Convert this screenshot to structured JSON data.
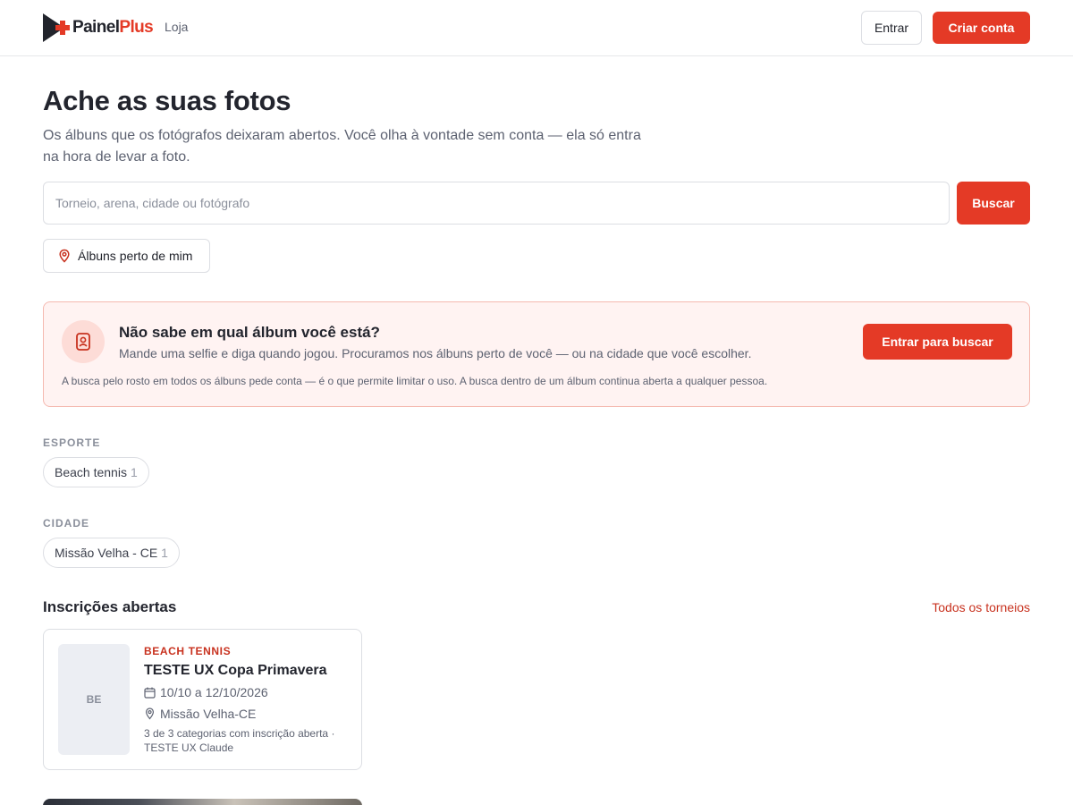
{
  "header": {
    "logo_text_a": "Painel",
    "logo_text_b": "Plus",
    "nav_store": "Loja",
    "login_label": "Entrar",
    "signup_label": "Criar conta"
  },
  "hero": {
    "title": "Ache as suas fotos",
    "subtitle": "Os álbuns que os fotógrafos deixaram abertos. Você olha à vontade sem conta — ela só entra na hora de levar a foto."
  },
  "search": {
    "placeholder": "Torneio, arena, cidade ou fotógrafo",
    "button_label": "Buscar",
    "near_label": "Álbuns perto de mim"
  },
  "promo": {
    "title": "Não sabe em qual álbum você está?",
    "text": "Mande uma selfie e diga quando jogou. Procuramos nos álbuns perto de você — ou na cidade que você escolher.",
    "note": "A busca pelo rosto em todos os álbuns pede conta — é o que permite limitar o uso. A busca dentro de um álbum continua aberta a qualquer pessoa.",
    "button_label": "Entrar para buscar"
  },
  "filters": {
    "sport_label": "ESPORTE",
    "sport_chip": {
      "label": "Beach tennis",
      "count": "1"
    },
    "city_label": "CIDADE",
    "city_chip": {
      "label": "Missão Velha - CE",
      "count": "1"
    }
  },
  "open": {
    "title": "Inscrições abertas",
    "link": "Todos os torneios"
  },
  "card": {
    "thumb": "BE",
    "sport": "BEACH TENNIS",
    "title": "TESTE UX Copa Primavera",
    "dates": "10/10 a 12/10/2026",
    "location": "Missão Velha-CE",
    "footer": "3 de 3 categorias com inscrição aberta · TESTE UX Claude"
  },
  "colors": {
    "accent": "#e43a26",
    "accent_text": "#c8321f",
    "promo_bg": "#fff3f2",
    "promo_border": "#f5b9b0"
  }
}
